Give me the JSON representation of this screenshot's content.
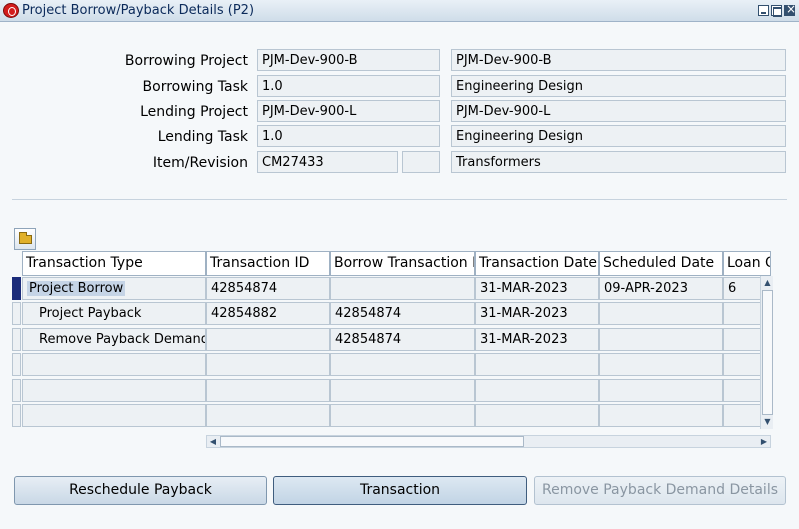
{
  "window": {
    "title": "Project Borrow/Payback Details (P2)"
  },
  "header": {
    "borrowing_project": {
      "label": "Borrowing Project",
      "value": "PJM-Dev-900-B",
      "description": "PJM-Dev-900-B"
    },
    "borrowing_task": {
      "label": "Borrowing Task",
      "value": "1.0",
      "description": "Engineering Design"
    },
    "lending_project": {
      "label": "Lending Project",
      "value": "PJM-Dev-900-L",
      "description": "PJM-Dev-900-L"
    },
    "lending_task": {
      "label": "Lending Task",
      "value": "1.0",
      "description": "Engineering Design"
    },
    "item_revision": {
      "label": "Item/Revision",
      "value": "CM27433",
      "revision": "",
      "description": "Transformers"
    }
  },
  "table": {
    "columns": [
      "Transaction Type",
      "Transaction ID",
      "Borrow Transaction ID",
      "Transaction Date",
      "Scheduled Date",
      "Loan Q"
    ],
    "rows": [
      {
        "type": "Project Borrow",
        "txn_id": "42854874",
        "borrow_txn_id": "",
        "txn_date": "31-MAR-2023",
        "scheduled_date": "09-APR-2023",
        "loan_qty": "6"
      },
      {
        "type": "Project Payback",
        "txn_id": "42854882",
        "borrow_txn_id": "42854874",
        "txn_date": "31-MAR-2023",
        "scheduled_date": "",
        "loan_qty": ""
      },
      {
        "type": "Remove Payback Demand",
        "txn_id": "",
        "borrow_txn_id": "42854874",
        "txn_date": "31-MAR-2023",
        "scheduled_date": "",
        "loan_qty": ""
      },
      {
        "type": "",
        "txn_id": "",
        "borrow_txn_id": "",
        "txn_date": "",
        "scheduled_date": "",
        "loan_qty": ""
      },
      {
        "type": "",
        "txn_id": "",
        "borrow_txn_id": "",
        "txn_date": "",
        "scheduled_date": "",
        "loan_qty": ""
      },
      {
        "type": "",
        "txn_id": "",
        "borrow_txn_id": "",
        "txn_date": "",
        "scheduled_date": "",
        "loan_qty": ""
      }
    ]
  },
  "buttons": {
    "reschedule": "Reschedule Payback",
    "transaction": "Transaction",
    "remove_demand": "Remove Payback Demand Details"
  },
  "icons": [
    "oracle-icon",
    "minimize-icon",
    "maximize-icon",
    "close-icon",
    "folder-icon",
    "scroll-up-icon",
    "scroll-down-icon",
    "scroll-left-icon",
    "scroll-right-icon"
  ],
  "colors": {
    "current_row_marker": "#1b2c7a",
    "title_text": "#0b2a5a"
  }
}
